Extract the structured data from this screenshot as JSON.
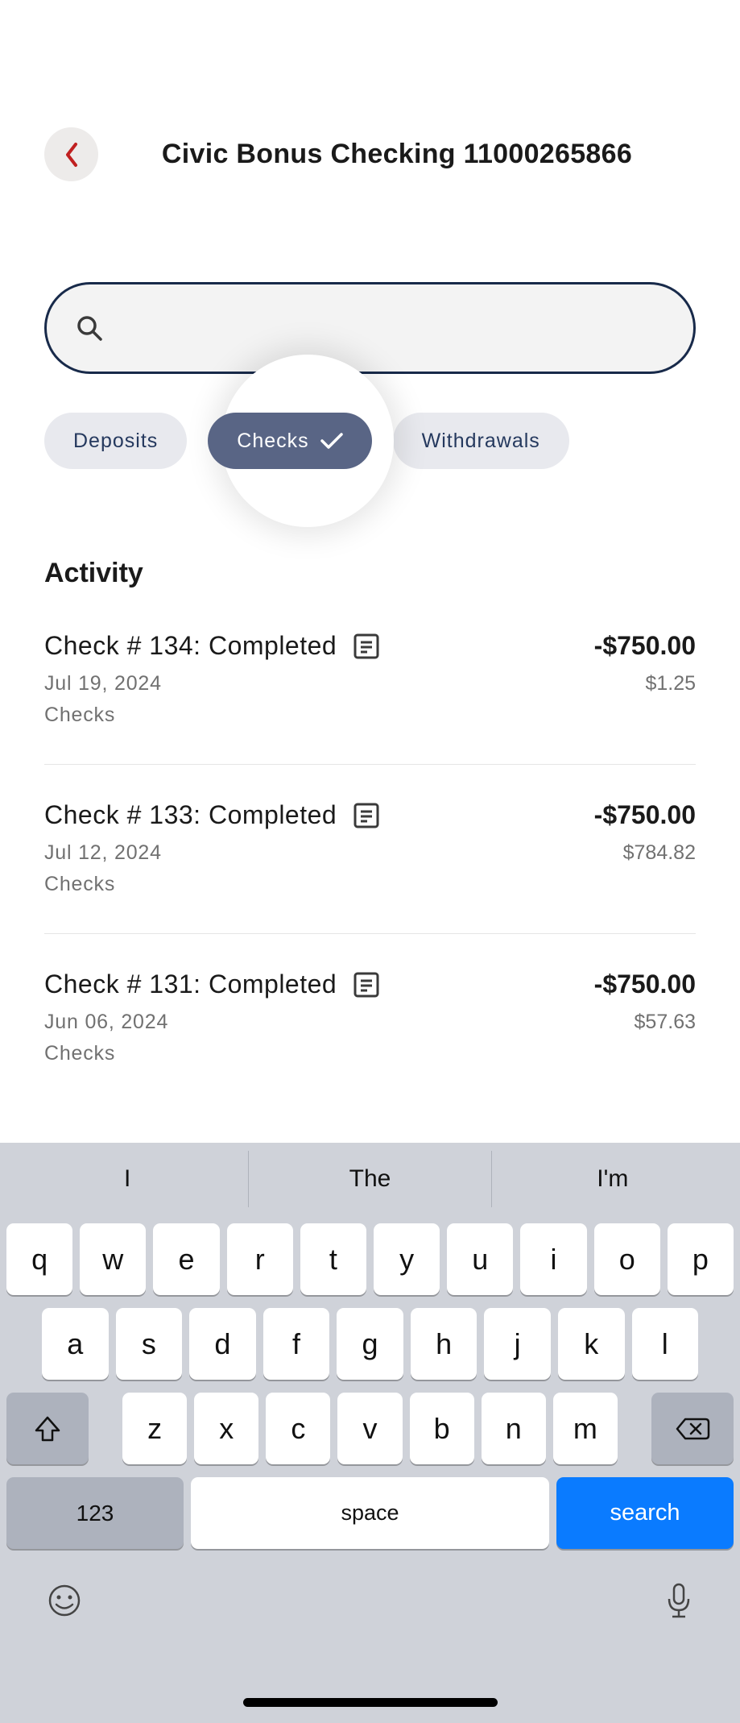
{
  "header": {
    "title": "Civic Bonus Checking 11000265866"
  },
  "search": {
    "placeholder": ""
  },
  "filters": {
    "deposits": "Deposits",
    "checks": "Checks",
    "withdrawals": "Withdrawals",
    "active": "checks"
  },
  "section": {
    "title": "Activity"
  },
  "transactions": [
    {
      "title": "Check # 134: Completed",
      "amount": "-$750.00",
      "date": "Jul 19, 2024",
      "sub": "$1.25",
      "category": "Checks"
    },
    {
      "title": "Check # 133: Completed",
      "amount": "-$750.00",
      "date": "Jul 12, 2024",
      "sub": "$784.82",
      "category": "Checks"
    },
    {
      "title": "Check # 131: Completed",
      "amount": "-$750.00",
      "date": "Jun 06, 2024",
      "sub": "$57.63",
      "category": "Checks"
    }
  ],
  "keyboard": {
    "suggestions": [
      "I",
      "The",
      "I'm"
    ],
    "row1": [
      "q",
      "w",
      "e",
      "r",
      "t",
      "y",
      "u",
      "i",
      "o",
      "p"
    ],
    "row2": [
      "a",
      "s",
      "d",
      "f",
      "g",
      "h",
      "j",
      "k",
      "l"
    ],
    "row3": [
      "z",
      "x",
      "c",
      "v",
      "b",
      "n",
      "m"
    ],
    "numbers": "123",
    "space": "space",
    "search": "search"
  }
}
